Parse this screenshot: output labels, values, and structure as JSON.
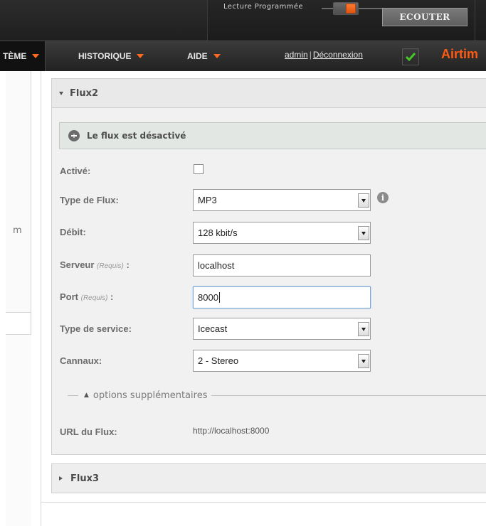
{
  "topbar": {
    "lecture_label": "Lecture Programmée",
    "listen_button": "ECOUTER"
  },
  "nav": {
    "items": [
      {
        "label": "TÈME"
      },
      {
        "label": "HISTORIQUE"
      },
      {
        "label": "AIDE"
      }
    ],
    "user": "admin",
    "separator": "|",
    "logout": "Déconnexion",
    "brand": "Airtim"
  },
  "left": {
    "partial_text": "m"
  },
  "flux2": {
    "title": "Flux2",
    "status": "Le flux est désactivé",
    "fields": {
      "active_label": "Activé:",
      "type_label": "Type de Flux:",
      "type_value": "MP3",
      "bitrate_label": "Débit:",
      "bitrate_value": "128 kbit/s",
      "server_label": "Serveur",
      "server_required": "(Requis)",
      "server_colon": ":",
      "server_value": "localhost",
      "port_label": "Port",
      "port_required": "(Requis)",
      "port_colon": ":",
      "port_value": "8000",
      "service_label": "Type de service:",
      "service_value": "Icecast",
      "channels_label": "Cannaux:",
      "channels_value": "2 - Stereo"
    },
    "extra_options": "options supplémentaires",
    "url_label": "URL du Flux:",
    "url_value": "http://localhost:8000"
  },
  "flux3": {
    "title": "Flux3"
  },
  "colors": {
    "accent": "#ff6a1f",
    "brand": "#ff5a14",
    "check": "#47c72a"
  }
}
